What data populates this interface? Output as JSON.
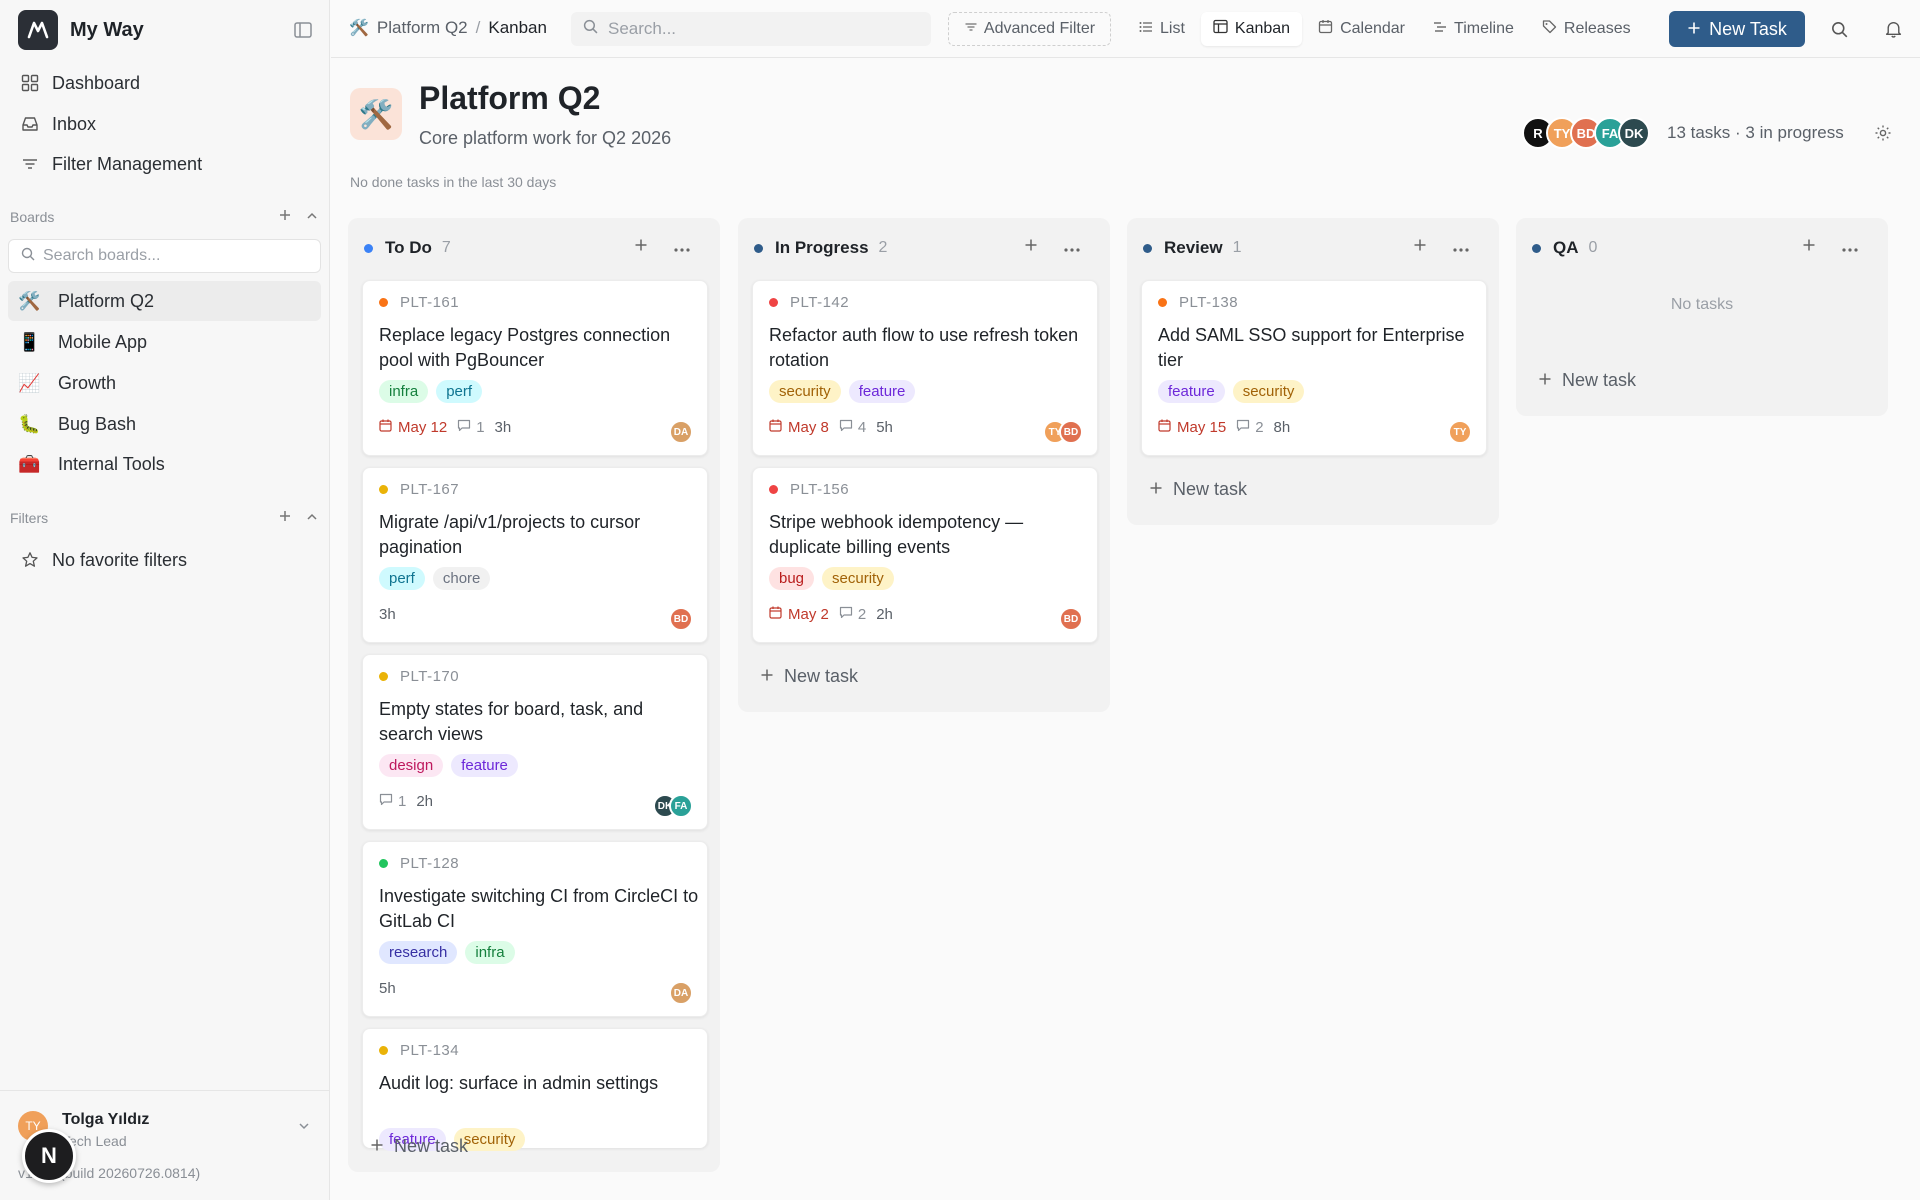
{
  "app": {
    "name": "My Way",
    "version": "v1.2.1 (build 20260726.0814)"
  },
  "nav": [
    {
      "label": "Dashboard",
      "icon": "grid-icon"
    },
    {
      "label": "Inbox",
      "icon": "inbox-icon"
    },
    {
      "label": "Filter Management",
      "icon": "filter-lines-icon"
    }
  ],
  "boards_section": {
    "label": "Boards",
    "search_placeholder": "Search boards..."
  },
  "boards": [
    {
      "label": "Platform Q2",
      "emoji": "🛠️",
      "active": true
    },
    {
      "label": "Mobile App",
      "emoji": "📱"
    },
    {
      "label": "Growth",
      "emoji": "📈"
    },
    {
      "label": "Bug Bash",
      "emoji": "🐛"
    },
    {
      "label": "Internal Tools",
      "emoji": "🧰"
    }
  ],
  "filters_section": {
    "label": "Filters",
    "empty_label": "No favorite filters"
  },
  "user": {
    "name": "Tolga Yıldız",
    "role": "Tech Lead",
    "initials": "TY",
    "badge": "N"
  },
  "breadcrumb": {
    "board": "Platform Q2",
    "view": "Kanban",
    "sep": "/"
  },
  "search": {
    "placeholder": "Search..."
  },
  "toolbar": {
    "advanced_filter": "Advanced Filter",
    "tabs": [
      "List",
      "Kanban",
      "Calendar",
      "Timeline",
      "Releases"
    ],
    "active_tab": "Kanban",
    "new_task": "New Task"
  },
  "board": {
    "emoji": "🛠️",
    "title": "Platform Q2",
    "subtitle": "Core platform work for Q2 2026",
    "note": "No done tasks in the last 30 days",
    "summary": "13 tasks · 3 in progress",
    "members": [
      {
        "initials": "R",
        "color": "#111111"
      },
      {
        "initials": "TY",
        "color": "#f0a05a"
      },
      {
        "initials": "BD",
        "color": "#e07050"
      },
      {
        "initials": "FA",
        "color": "#2aa198"
      },
      {
        "initials": "DK",
        "color": "#2d4a4f"
      }
    ]
  },
  "columns": [
    {
      "name": "To Do",
      "count": "7",
      "dot": "#3b82f6",
      "new_task": "New task",
      "cards": [
        {
          "id": "PLT-161",
          "priority": "#f97316",
          "title": "Replace legacy Postgres connection pool with PgBouncer",
          "tags": [
            {
              "label": "infra",
              "bg": "#dcfce7",
              "fg": "#15803d"
            },
            {
              "label": "perf",
              "bg": "#cffafe",
              "fg": "#0e7490"
            }
          ],
          "due": "May 12",
          "comments": "1",
          "estimate": "3h",
          "assignees": [
            {
              "initials": "DA",
              "color": "#d9a066"
            }
          ]
        },
        {
          "id": "PLT-167",
          "priority": "#eab308",
          "title": "Migrate /api/v1/projects to cursor pagination",
          "tags": [
            {
              "label": "perf",
              "bg": "#cffafe",
              "fg": "#0e7490"
            },
            {
              "label": "chore",
              "bg": "#f1f1f1",
              "fg": "#6b7280"
            }
          ],
          "due": "",
          "comments": "",
          "estimate": "3h",
          "assignees": [
            {
              "initials": "BD",
              "color": "#e07050"
            }
          ]
        },
        {
          "id": "PLT-170",
          "priority": "#eab308",
          "title": "Empty states for board, task, and search views",
          "tags": [
            {
              "label": "design",
              "bg": "#fce7f3",
              "fg": "#be185d"
            },
            {
              "label": "feature",
              "bg": "#ede9fe",
              "fg": "#6d28d9"
            }
          ],
          "due": "",
          "comments": "1",
          "estimate": "2h",
          "assignees": [
            {
              "initials": "DK",
              "color": "#2d4a4f"
            },
            {
              "initials": "FA",
              "color": "#2aa198"
            }
          ]
        },
        {
          "id": "PLT-128",
          "priority": "#22c55e",
          "title": "Investigate switching CI from CircleCI to GitLab CI",
          "tags": [
            {
              "label": "research",
              "bg": "#e0e7ff",
              "fg": "#3730a3"
            },
            {
              "label": "infra",
              "bg": "#dcfce7",
              "fg": "#15803d"
            }
          ],
          "due": "",
          "comments": "",
          "estimate": "5h",
          "assignees": [
            {
              "initials": "DA",
              "color": "#d9a066"
            }
          ]
        },
        {
          "id": "PLT-134",
          "priority": "#eab308",
          "title": "Audit log: surface in admin settings",
          "tags": [
            {
              "label": "feature",
              "bg": "#ede9fe",
              "fg": "#6d28d9"
            },
            {
              "label": "security",
              "bg": "#fef3c7",
              "fg": "#a16207"
            }
          ],
          "due": "",
          "comments": "",
          "estimate": "",
          "assignees": []
        }
      ]
    },
    {
      "name": "In Progress",
      "count": "2",
      "dot": "#2f5c8a",
      "new_task": "New task",
      "cards": [
        {
          "id": "PLT-142",
          "priority": "#ef4444",
          "title": "Refactor auth flow to use refresh token rotation",
          "tags": [
            {
              "label": "security",
              "bg": "#fef3c7",
              "fg": "#a16207"
            },
            {
              "label": "feature",
              "bg": "#ede9fe",
              "fg": "#6d28d9"
            }
          ],
          "due": "May 8",
          "comments": "4",
          "estimate": "5h",
          "assignees": [
            {
              "initials": "TY",
              "color": "#f0a05a"
            },
            {
              "initials": "BD",
              "color": "#e07050"
            }
          ]
        },
        {
          "id": "PLT-156",
          "priority": "#ef4444",
          "title": "Stripe webhook idempotency — duplicate billing events",
          "tags": [
            {
              "label": "bug",
              "bg": "#fee2e2",
              "fg": "#b91c1c"
            },
            {
              "label": "security",
              "bg": "#fef3c7",
              "fg": "#a16207"
            }
          ],
          "due": "May 2",
          "comments": "2",
          "estimate": "2h",
          "assignees": [
            {
              "initials": "BD",
              "color": "#e07050"
            }
          ]
        }
      ]
    },
    {
      "name": "Review",
      "count": "1",
      "dot": "#2f5c8a",
      "new_task": "New task",
      "cards": [
        {
          "id": "PLT-138",
          "priority": "#f97316",
          "title": "Add SAML SSO support for Enterprise tier",
          "tags": [
            {
              "label": "feature",
              "bg": "#ede9fe",
              "fg": "#6d28d9"
            },
            {
              "label": "security",
              "bg": "#fef3c7",
              "fg": "#a16207"
            }
          ],
          "due": "May 15",
          "comments": "2",
          "estimate": "8h",
          "assignees": [
            {
              "initials": "TY",
              "color": "#f0a05a"
            }
          ]
        }
      ]
    },
    {
      "name": "QA",
      "count": "0",
      "dot": "#2f5c8a",
      "new_task": "New task",
      "empty_label": "No tasks",
      "cards": []
    }
  ]
}
